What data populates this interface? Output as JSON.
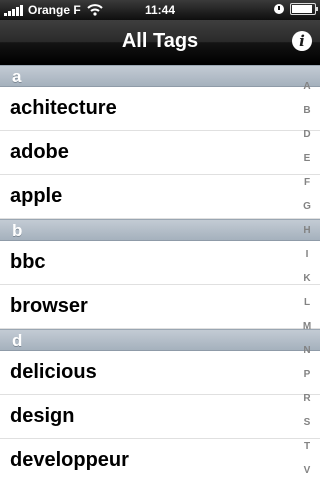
{
  "status_bar": {
    "carrier": "Orange F",
    "time": "11:44"
  },
  "navbar": {
    "title": "All Tags",
    "info_label": "i"
  },
  "sections": [
    {
      "header": "a",
      "items": [
        "achitecture",
        "adobe",
        "apple"
      ]
    },
    {
      "header": "b",
      "items": [
        "bbc",
        "browser"
      ]
    },
    {
      "header": "d",
      "items": [
        "delicious",
        "design",
        "developpeur"
      ]
    }
  ],
  "index_letters": [
    "A",
    "B",
    "D",
    "E",
    "F",
    "G",
    "H",
    "I",
    "K",
    "L",
    "M",
    "N",
    "P",
    "R",
    "S",
    "T",
    "V"
  ]
}
